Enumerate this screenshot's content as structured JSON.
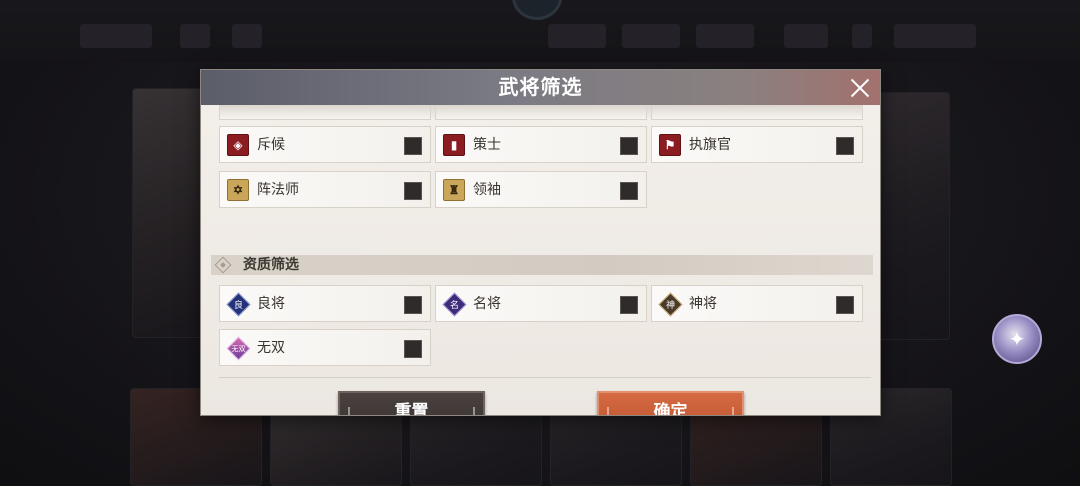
{
  "modal": {
    "title": "武将筛选",
    "close_icon": "close-icon"
  },
  "role_options": [
    {
      "label": "斥候",
      "icon": "scout-icon",
      "icon_color": "#8b1c22",
      "checked": false
    },
    {
      "label": "策士",
      "icon": "strategist-icon",
      "icon_color": "#8b1c22",
      "checked": false
    },
    {
      "label": "执旗官",
      "icon": "flag-icon",
      "icon_color": "#8b1c22",
      "checked": false
    },
    {
      "label": "阵法师",
      "icon": "formation-icon",
      "icon_color": "#c9a65a",
      "checked": false
    },
    {
      "label": "领袖",
      "icon": "leader-icon",
      "icon_color": "#c9a65a",
      "checked": false
    }
  ],
  "quality_section": {
    "title": "资质筛选",
    "options": [
      {
        "label": "良将",
        "icon_text": "良",
        "icon_color": "#25327a",
        "checked": false
      },
      {
        "label": "名将",
        "icon_text": "名",
        "icon_color": "#3e2c7a",
        "checked": false
      },
      {
        "label": "神将",
        "icon_text": "神",
        "icon_color": "#4a3a2a",
        "checked": false
      },
      {
        "label": "无双",
        "icon_text": "无双",
        "icon_color": "#6b3f9c",
        "checked": false
      }
    ]
  },
  "buttons": {
    "reset_label": "重置",
    "confirm_label": "确定"
  },
  "colors": {
    "header_bg": "#7b7b84",
    "confirm_button": "#c95d36",
    "reset_button": "#3e3734",
    "checkbox": "#2e2b2a"
  }
}
